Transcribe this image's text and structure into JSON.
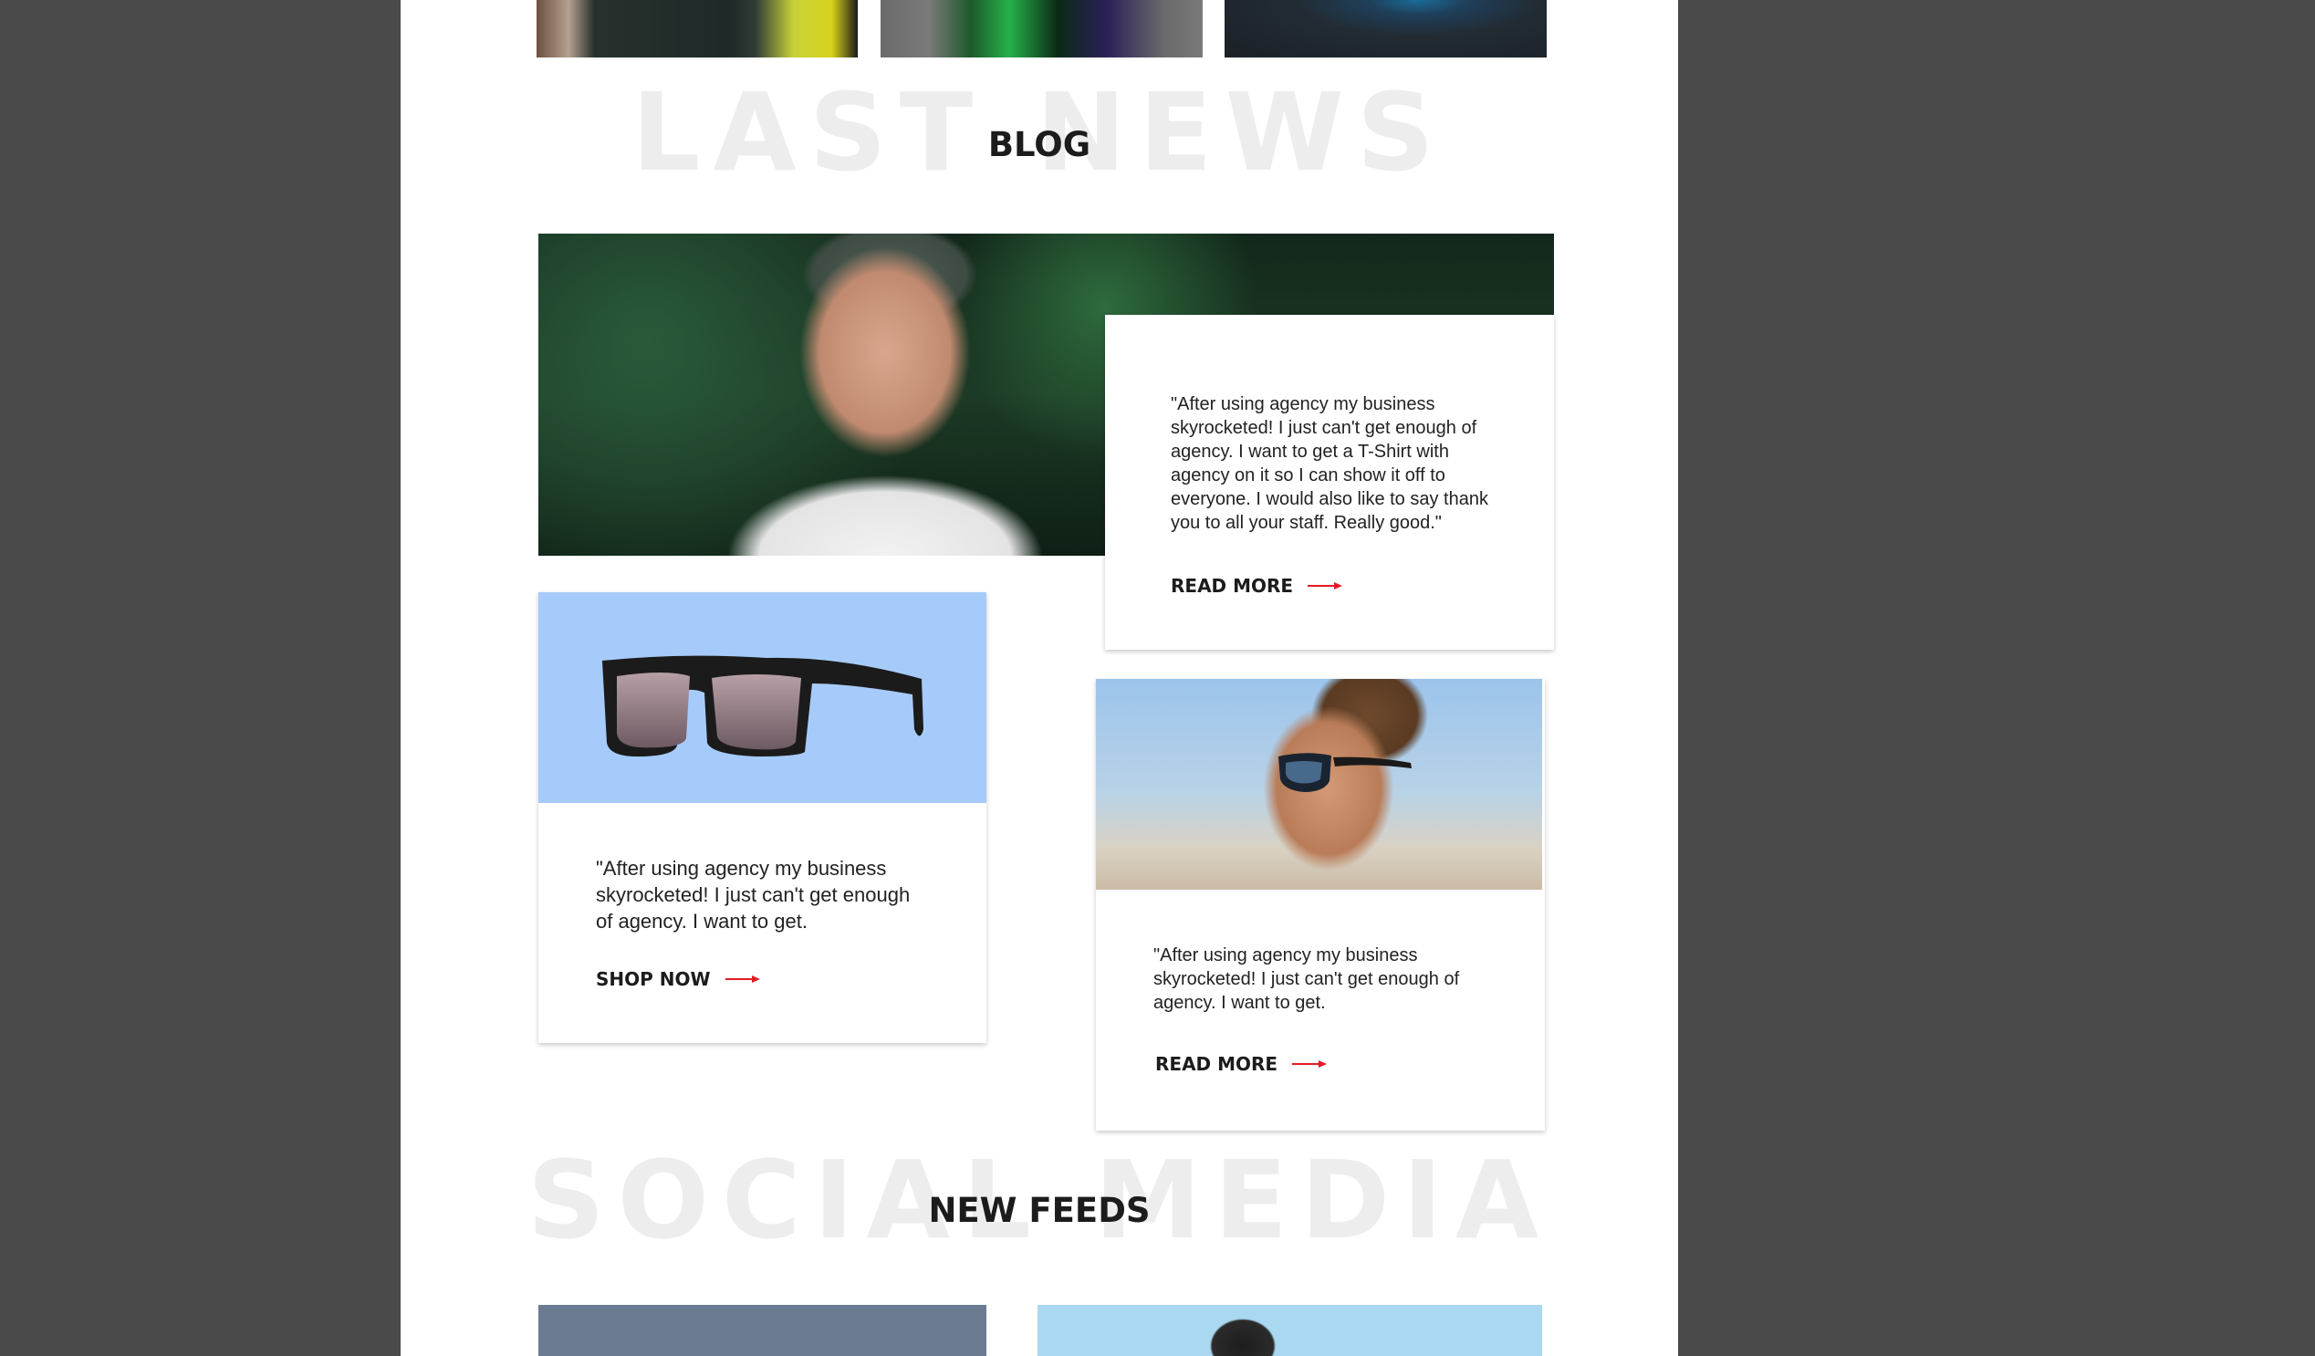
{
  "blog_section": {
    "background_title": "LAST NEWS",
    "title": "BLOG",
    "posts": [
      {
        "quote": "\"After using agency my business skyrocketed! I just can't get enough of agency. I want to get a T-Shirt with agency on it so I can show it off to everyone. I would also like to say thank you to all your staff. Really good.\"",
        "cta_label": "READ MORE"
      },
      {
        "quote": "\"After using agency my business skyrocketed! I just can't get enough of agency. I want to get.",
        "cta_label": "SHOP NOW"
      },
      {
        "quote": "\"After using agency my business skyrocketed! I just can't get enough of agency. I want to get.",
        "cta_label": "READ MORE"
      }
    ]
  },
  "social_section": {
    "background_title": "SOCIAL MEDIA",
    "title": "NEW FEEDS"
  },
  "colors": {
    "page_background": "#4a4a4a",
    "content_background": "#ffffff",
    "arrow_accent": "#e31b23",
    "product_tile_background": "#a6cbfa"
  }
}
